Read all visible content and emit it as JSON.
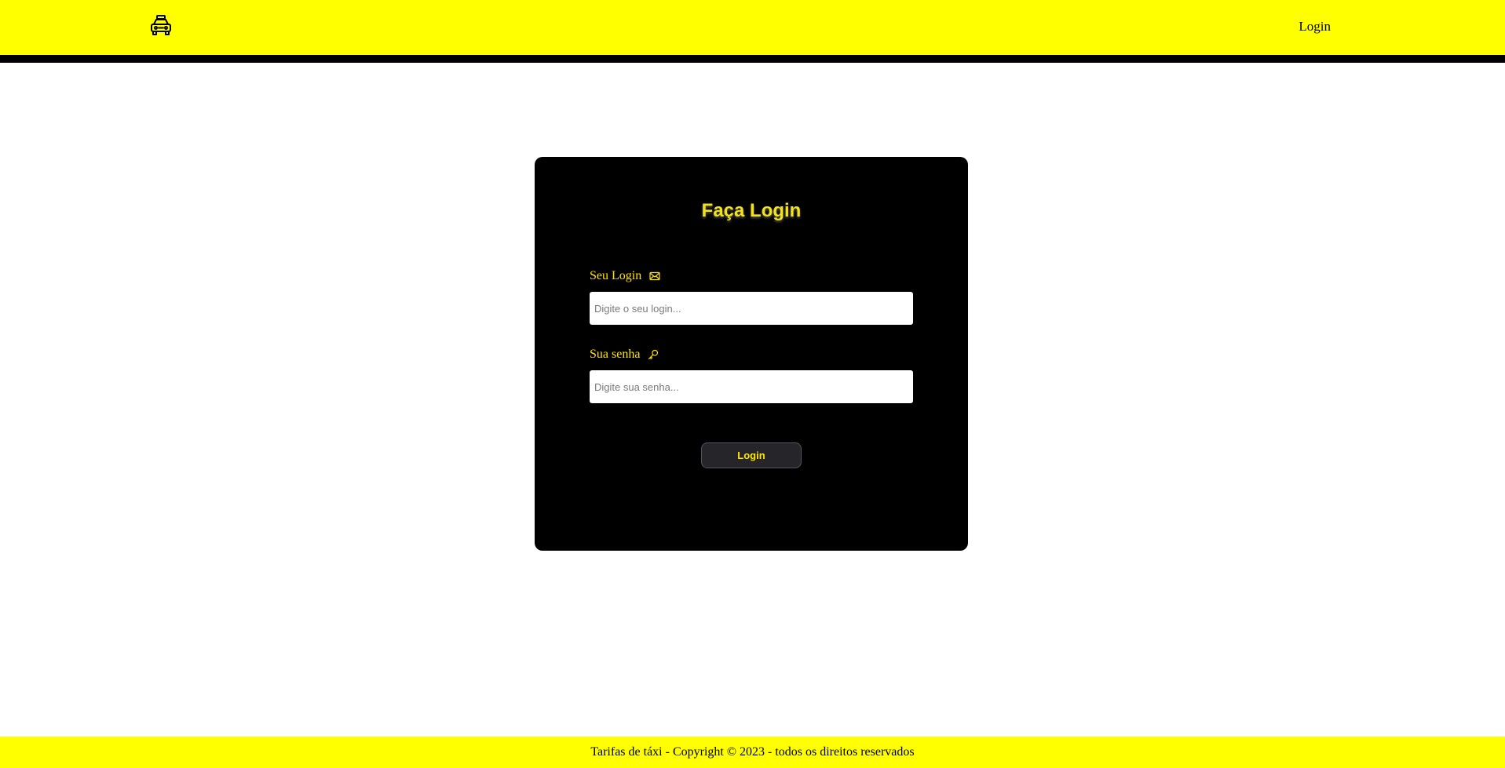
{
  "navbar": {
    "logo_icon": "taxi-icon",
    "login_link": "Login",
    "background_color": "#ffff00",
    "border_color": "#000000"
  },
  "login_card": {
    "title": "Faça Login",
    "login_field": {
      "label": "Seu Login",
      "icon": "envelope-icon",
      "value": "",
      "placeholder": "Digite o seu login..."
    },
    "password_field": {
      "label": "Sua senha",
      "icon": "key-icon",
      "value": "",
      "placeholder": "Digite sua senha..."
    },
    "submit_label": "Login",
    "background_color": "#000000",
    "accent_color": "#ffe600"
  },
  "footer": {
    "text": "Tarifas de táxi - Copyright © 2023 - todos os direitos reservados"
  }
}
